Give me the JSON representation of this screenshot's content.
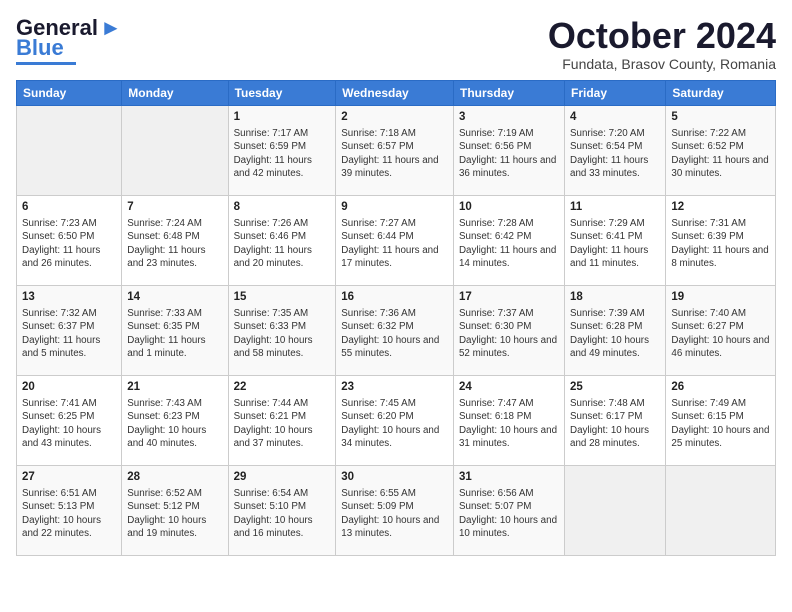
{
  "logo": {
    "line1": "General",
    "line2": "Blue"
  },
  "title": "October 2024",
  "subtitle": "Fundata, Brasov County, Romania",
  "headers": [
    "Sunday",
    "Monday",
    "Tuesday",
    "Wednesday",
    "Thursday",
    "Friday",
    "Saturday"
  ],
  "weeks": [
    [
      {
        "day": "",
        "info": ""
      },
      {
        "day": "",
        "info": ""
      },
      {
        "day": "1",
        "info": "Sunrise: 7:17 AM\nSunset: 6:59 PM\nDaylight: 11 hours and 42 minutes."
      },
      {
        "day": "2",
        "info": "Sunrise: 7:18 AM\nSunset: 6:57 PM\nDaylight: 11 hours and 39 minutes."
      },
      {
        "day": "3",
        "info": "Sunrise: 7:19 AM\nSunset: 6:56 PM\nDaylight: 11 hours and 36 minutes."
      },
      {
        "day": "4",
        "info": "Sunrise: 7:20 AM\nSunset: 6:54 PM\nDaylight: 11 hours and 33 minutes."
      },
      {
        "day": "5",
        "info": "Sunrise: 7:22 AM\nSunset: 6:52 PM\nDaylight: 11 hours and 30 minutes."
      }
    ],
    [
      {
        "day": "6",
        "info": "Sunrise: 7:23 AM\nSunset: 6:50 PM\nDaylight: 11 hours and 26 minutes."
      },
      {
        "day": "7",
        "info": "Sunrise: 7:24 AM\nSunset: 6:48 PM\nDaylight: 11 hours and 23 minutes."
      },
      {
        "day": "8",
        "info": "Sunrise: 7:26 AM\nSunset: 6:46 PM\nDaylight: 11 hours and 20 minutes."
      },
      {
        "day": "9",
        "info": "Sunrise: 7:27 AM\nSunset: 6:44 PM\nDaylight: 11 hours and 17 minutes."
      },
      {
        "day": "10",
        "info": "Sunrise: 7:28 AM\nSunset: 6:42 PM\nDaylight: 11 hours and 14 minutes."
      },
      {
        "day": "11",
        "info": "Sunrise: 7:29 AM\nSunset: 6:41 PM\nDaylight: 11 hours and 11 minutes."
      },
      {
        "day": "12",
        "info": "Sunrise: 7:31 AM\nSunset: 6:39 PM\nDaylight: 11 hours and 8 minutes."
      }
    ],
    [
      {
        "day": "13",
        "info": "Sunrise: 7:32 AM\nSunset: 6:37 PM\nDaylight: 11 hours and 5 minutes."
      },
      {
        "day": "14",
        "info": "Sunrise: 7:33 AM\nSunset: 6:35 PM\nDaylight: 11 hours and 1 minute."
      },
      {
        "day": "15",
        "info": "Sunrise: 7:35 AM\nSunset: 6:33 PM\nDaylight: 10 hours and 58 minutes."
      },
      {
        "day": "16",
        "info": "Sunrise: 7:36 AM\nSunset: 6:32 PM\nDaylight: 10 hours and 55 minutes."
      },
      {
        "day": "17",
        "info": "Sunrise: 7:37 AM\nSunset: 6:30 PM\nDaylight: 10 hours and 52 minutes."
      },
      {
        "day": "18",
        "info": "Sunrise: 7:39 AM\nSunset: 6:28 PM\nDaylight: 10 hours and 49 minutes."
      },
      {
        "day": "19",
        "info": "Sunrise: 7:40 AM\nSunset: 6:27 PM\nDaylight: 10 hours and 46 minutes."
      }
    ],
    [
      {
        "day": "20",
        "info": "Sunrise: 7:41 AM\nSunset: 6:25 PM\nDaylight: 10 hours and 43 minutes."
      },
      {
        "day": "21",
        "info": "Sunrise: 7:43 AM\nSunset: 6:23 PM\nDaylight: 10 hours and 40 minutes."
      },
      {
        "day": "22",
        "info": "Sunrise: 7:44 AM\nSunset: 6:21 PM\nDaylight: 10 hours and 37 minutes."
      },
      {
        "day": "23",
        "info": "Sunrise: 7:45 AM\nSunset: 6:20 PM\nDaylight: 10 hours and 34 minutes."
      },
      {
        "day": "24",
        "info": "Sunrise: 7:47 AM\nSunset: 6:18 PM\nDaylight: 10 hours and 31 minutes."
      },
      {
        "day": "25",
        "info": "Sunrise: 7:48 AM\nSunset: 6:17 PM\nDaylight: 10 hours and 28 minutes."
      },
      {
        "day": "26",
        "info": "Sunrise: 7:49 AM\nSunset: 6:15 PM\nDaylight: 10 hours and 25 minutes."
      }
    ],
    [
      {
        "day": "27",
        "info": "Sunrise: 6:51 AM\nSunset: 5:13 PM\nDaylight: 10 hours and 22 minutes."
      },
      {
        "day": "28",
        "info": "Sunrise: 6:52 AM\nSunset: 5:12 PM\nDaylight: 10 hours and 19 minutes."
      },
      {
        "day": "29",
        "info": "Sunrise: 6:54 AM\nSunset: 5:10 PM\nDaylight: 10 hours and 16 minutes."
      },
      {
        "day": "30",
        "info": "Sunrise: 6:55 AM\nSunset: 5:09 PM\nDaylight: 10 hours and 13 minutes."
      },
      {
        "day": "31",
        "info": "Sunrise: 6:56 AM\nSunset: 5:07 PM\nDaylight: 10 hours and 10 minutes."
      },
      {
        "day": "",
        "info": ""
      },
      {
        "day": "",
        "info": ""
      }
    ]
  ]
}
